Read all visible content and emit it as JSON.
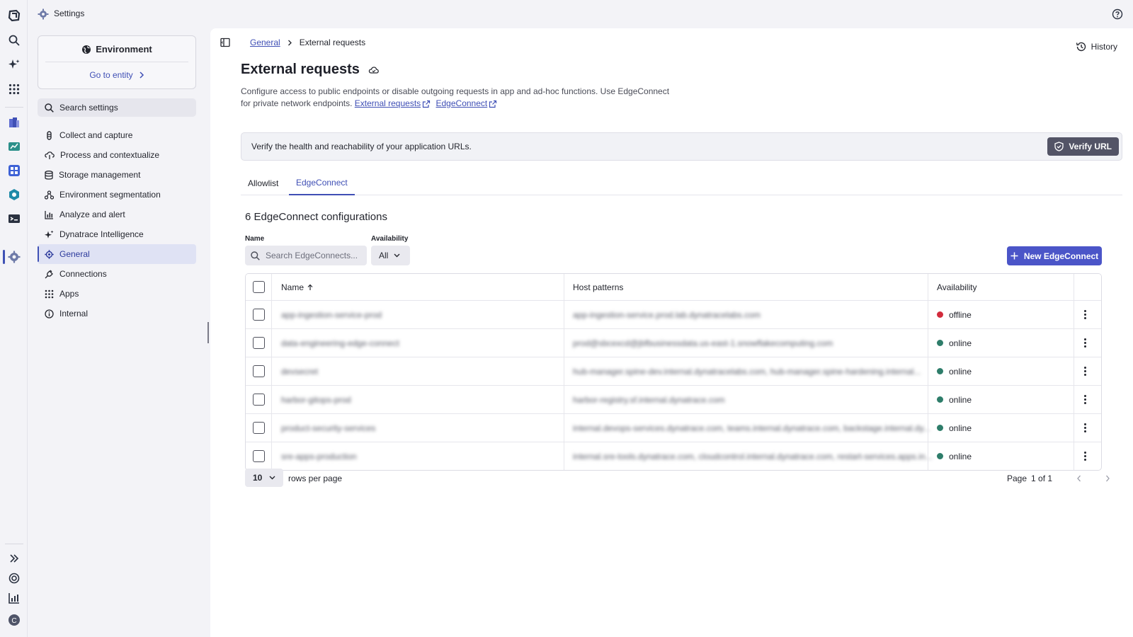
{
  "app": {
    "title": "Settings"
  },
  "sidebar": {
    "environment_title": "Environment",
    "go_to_entity": "Go to entity",
    "search_placeholder": "Search settings",
    "items": [
      {
        "label": "Collect and capture",
        "icon": "capture-icon"
      },
      {
        "label": "Process and contextualize",
        "icon": "process-icon"
      },
      {
        "label": "Storage management",
        "icon": "database-icon"
      },
      {
        "label": "Environment segmentation",
        "icon": "segmentation-icon"
      },
      {
        "label": "Analyze and alert",
        "icon": "chart-icon"
      },
      {
        "label": "Dynatrace Intelligence",
        "icon": "sparkle-icon"
      },
      {
        "label": "General",
        "icon": "gear-icon",
        "active": true
      },
      {
        "label": "Connections",
        "icon": "plug-icon"
      },
      {
        "label": "Apps",
        "icon": "grid-icon"
      },
      {
        "label": "Internal",
        "icon": "info-icon"
      }
    ]
  },
  "breadcrumb": {
    "parent": "General",
    "current": "External requests"
  },
  "header": {
    "history_label": "History",
    "title": "External requests",
    "description": "Configure access to public endpoints or disable outgoing requests in app and ad-hoc functions. Use EdgeConnect for private network endpoints.",
    "link_external_requests": "External requests",
    "link_edgeconnect": "EdgeConnect"
  },
  "banner": {
    "text": "Verify the health and reachability of your application URLs.",
    "button_label": "Verify URL"
  },
  "tabs": [
    {
      "label": "Allowlist",
      "active": false
    },
    {
      "label": "EdgeConnect",
      "active": true
    }
  ],
  "edgeconnect": {
    "count_title": "6 EdgeConnect configurations",
    "filters": {
      "name_label": "Name",
      "name_placeholder": "Search EdgeConnects...",
      "availability_label": "Availability",
      "availability_value": "All"
    },
    "new_button_label": "New EdgeConnect",
    "table": {
      "columns": [
        "Name",
        "Host patterns",
        "Availability"
      ],
      "rows": [
        {
          "name": "app-ingestion-service-prod",
          "hosts": "app-ingestion-service.prod.lab.dynatracelabs.com",
          "availability": "offline"
        },
        {
          "name": "data-engineering-edge-connect",
          "hosts": "prod@sbcexcd@jbfbusinessdata.us-east-1.snowflakecomputing.com",
          "availability": "online"
        },
        {
          "name": "devsecret",
          "hosts": "hub-manager.spine-dev.internal.dynatracelabs.com, hub-manager.spine-hardening.internal...",
          "availability": "online"
        },
        {
          "name": "harbor-gitops-prod",
          "hosts": "harbor-registry.sf.internal.dynatrace.com",
          "availability": "online"
        },
        {
          "name": "product-security-services",
          "hosts": "internal.devops-services.dynatrace.com, teams.internal.dynatrace.com, backstage.internal.dy...",
          "availability": "online"
        },
        {
          "name": "sre-apps-production",
          "hosts": "internal.sre-tools.dynatrace.com, cloudcontrol.internal.dynatrace.com, restart-services.apps.in...",
          "availability": "online"
        }
      ]
    },
    "pagination": {
      "rows_per_page_value": "10",
      "rows_per_page_label": "rows per page",
      "page_label": "Page",
      "page_value": "1 of 1"
    }
  },
  "colors": {
    "accent": "#3f51b5",
    "primary_button": "#4b55c8",
    "online": "#2e7d6a",
    "offline": "#d22b3c"
  }
}
